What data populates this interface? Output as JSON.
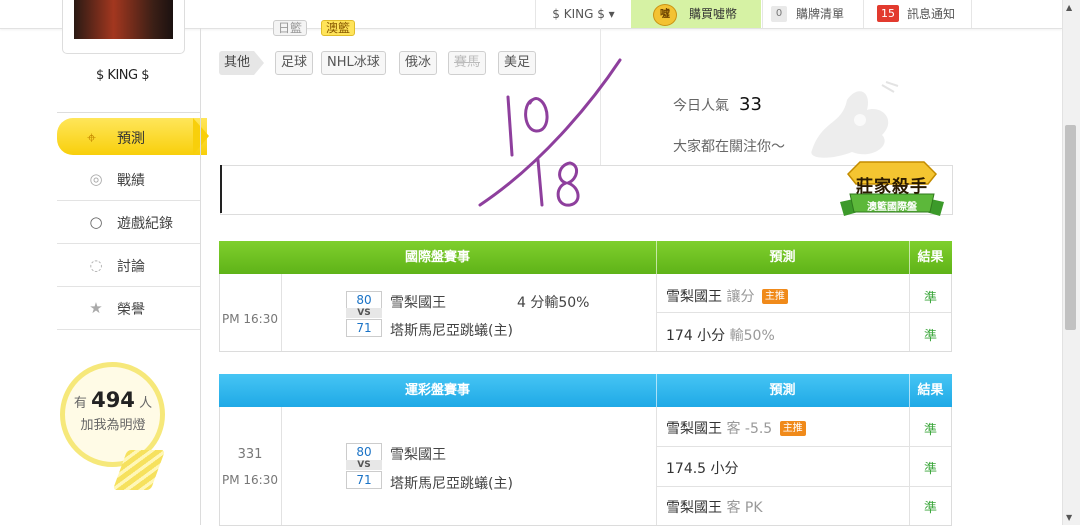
{
  "topbar": {
    "user": "$ KING $ ▾",
    "buy_coin": "購買噓幣",
    "coin_glyph": "噓",
    "cart_count": "0",
    "cart_label": "購牌清單",
    "notice_count": "15",
    "notice_label": "訊息通知"
  },
  "sidebar": {
    "username": "$ KING $",
    "menu": [
      {
        "label": "預測",
        "icon": "target-icon",
        "active": true
      },
      {
        "label": "戰績",
        "icon": "trophy-icon"
      },
      {
        "label": "遊戲紀錄",
        "icon": "record-icon"
      },
      {
        "label": "討論",
        "icon": "discussion-icon"
      },
      {
        "label": "榮譽",
        "icon": "medal-icon"
      }
    ],
    "fans": {
      "prefix": "有",
      "count": "494",
      "suffix": "人",
      "text": "加我為明燈"
    }
  },
  "categories": {
    "top_partial": [
      "日籃",
      "澳籃"
    ],
    "first": "其他",
    "items": [
      "足球",
      "NHL冰球",
      "俄冰",
      "賽馬",
      "美足"
    ]
  },
  "popularity": {
    "label": "今日人氣",
    "value": "33",
    "tagline": "大家都在關注你～"
  },
  "badge": {
    "title": "莊家殺手",
    "subtitle": "澳籃國際盤"
  },
  "annotation": {
    "text": "10/18",
    "color": "#8e3f9d"
  },
  "table_intl": {
    "headers": {
      "event": "國際盤賽事",
      "prediction": "預測",
      "result": "結果"
    },
    "time": "PM 16:30",
    "home_score": "80",
    "vs": "VS",
    "away_score": "71",
    "home_team": "雪梨國王",
    "away_team": "塔斯馬尼亞跳蟻(主)",
    "spread_note": "4 分輸50%",
    "predictions": [
      {
        "main": "雪梨國王",
        "detail": "讓分",
        "tag": "主推",
        "result": "準"
      },
      {
        "main": "174 小分",
        "detail": "輸50%",
        "tag": "",
        "result": "準"
      }
    ]
  },
  "table_sports": {
    "headers": {
      "event": "運彩盤賽事",
      "prediction": "預測",
      "result": "結果"
    },
    "game_no": "331",
    "time": "PM 16:30",
    "home_score": "80",
    "vs": "VS",
    "away_score": "71",
    "home_team": "雪梨國王",
    "away_team": "塔斯馬尼亞跳蟻(主)",
    "predictions": [
      {
        "main": "雪梨國王",
        "detail": "客 -5.5",
        "tag": "主推",
        "result": "準"
      },
      {
        "main": "174.5 小分",
        "detail": "",
        "tag": "",
        "result": "準"
      },
      {
        "main": "雪梨國王",
        "detail": "客 PK",
        "tag": "",
        "result": "準"
      }
    ]
  },
  "colors": {
    "accent_green": "#5fb318",
    "accent_blue": "#1fa9e6",
    "active_yellow": "#f8cf0b",
    "notice_red": "#e23a2e"
  }
}
